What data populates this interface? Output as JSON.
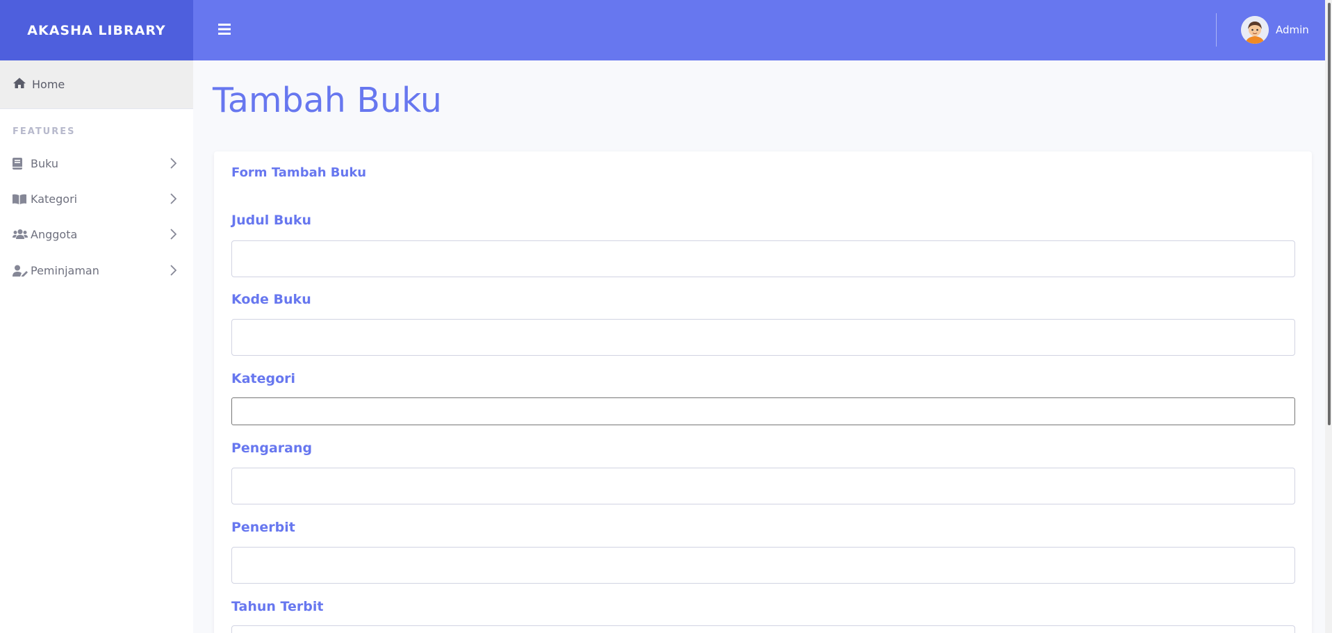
{
  "brand": {
    "title": "AKASHA LIBRARY"
  },
  "topbar": {
    "user_name": "Admin"
  },
  "sidebar": {
    "home_label": "Home",
    "section_heading": "FEATURES",
    "items": [
      {
        "label": "Buku",
        "icon": "book-icon"
      },
      {
        "label": "Kategori",
        "icon": "book-open-icon"
      },
      {
        "label": "Anggota",
        "icon": "users-icon"
      },
      {
        "label": "Peminjaman",
        "icon": "user-edit-icon"
      }
    ]
  },
  "main": {
    "page_title": "Tambah Buku",
    "card_title": "Form Tambah Buku",
    "fields": [
      {
        "label": "Judul Buku",
        "value": ""
      },
      {
        "label": "Kode Buku",
        "value": ""
      },
      {
        "label": "Kategori",
        "value": ""
      },
      {
        "label": "Pengarang",
        "value": ""
      },
      {
        "label": "Penerbit",
        "value": ""
      },
      {
        "label": "Tahun Terbit",
        "value": ""
      }
    ]
  },
  "colors": {
    "primary": "#6777ef",
    "brand_bg": "#4e5fdd",
    "label_gray": "#6e707e",
    "section_gray": "#b7b9cc"
  }
}
